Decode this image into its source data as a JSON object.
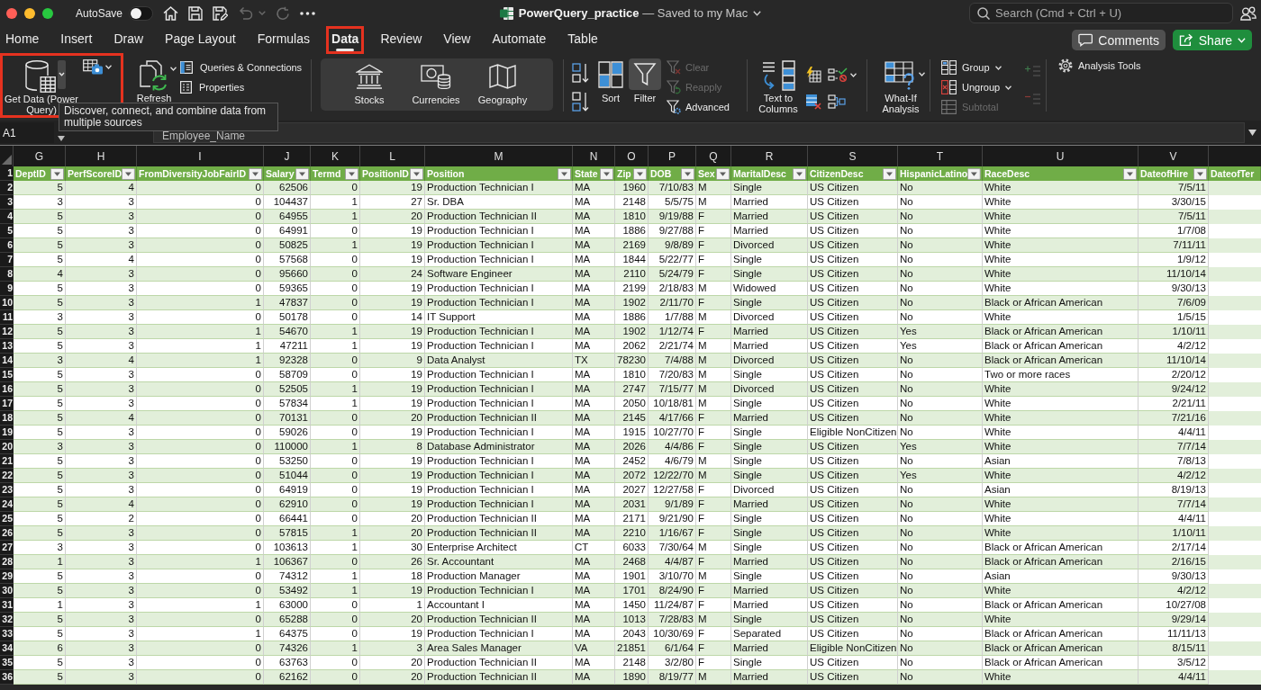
{
  "window": {
    "title": "**PowerQuery_practice** — Saved to my Mac",
    "autosave": {
      "label": "AutoSave",
      "on": false
    }
  },
  "search": {
    "placeholder": "Search (Cmd + Ctrl + U)"
  },
  "tabs": [
    {
      "label": "Home",
      "selected": false,
      "highlighted": false
    },
    {
      "label": "Insert",
      "selected": false,
      "highlighted": false
    },
    {
      "label": "Draw",
      "selected": false,
      "highlighted": false
    },
    {
      "label": "Page Layout",
      "selected": false,
      "highlighted": false
    },
    {
      "label": "Formulas",
      "selected": false,
      "highlighted": false
    },
    {
      "label": "Data",
      "selected": true,
      "highlighted": true
    },
    {
      "label": "Review",
      "selected": false,
      "highlighted": false
    },
    {
      "label": "View",
      "selected": false,
      "highlighted": false
    },
    {
      "label": "Automate",
      "selected": false,
      "highlighted": false
    },
    {
      "label": "Table",
      "selected": false,
      "highlighted": false
    }
  ],
  "actions": [
    {
      "label": "Comments",
      "kind": "comments"
    },
    {
      "label": "Share",
      "kind": "share"
    }
  ],
  "ribbon": {
    "get_data": {
      "label": "Get Data (Power Query)",
      "highlighted": true
    },
    "refresh": {
      "label": "Refresh"
    },
    "query_items": [
      {
        "label": "Queries & Connections",
        "kind": "queries"
      },
      {
        "label": "Properties",
        "kind": "properties"
      }
    ],
    "data_types": [
      {
        "label": "Stocks",
        "kind": "stocks"
      },
      {
        "label": "Currencies",
        "kind": "currencies"
      },
      {
        "label": "Geography",
        "kind": "geography"
      }
    ],
    "sort": {
      "label": "Sort"
    },
    "filter": {
      "label": "Filter",
      "on": true
    },
    "filter_items": [
      {
        "label": "Clear",
        "kind": "clear",
        "disabled": true
      },
      {
        "label": "Reapply",
        "kind": "reapply",
        "disabled": true
      },
      {
        "label": "Advanced",
        "kind": "advanced",
        "disabled": false
      }
    ],
    "text_to_columns": {
      "label": "Text to Columns"
    },
    "what_if": {
      "label": "What-If Analysis"
    },
    "outline_items": [
      {
        "label": "Group",
        "kind": "group",
        "disabled": false
      },
      {
        "label": "Ungroup",
        "kind": "ungroup",
        "disabled": false
      },
      {
        "label": "Subtotal",
        "kind": "subtotal",
        "disabled": true
      }
    ],
    "analysis_tools": {
      "label": "Analysis Tools"
    }
  },
  "tooltip": {
    "text": "Discover, connect, and combine data from multiple sources"
  },
  "formula_bar": {
    "name_box": "A1",
    "formula": "Employee_Name"
  },
  "sheet": {
    "column_letters": [
      "G",
      "H",
      "I",
      "J",
      "K",
      "L",
      "M",
      "N",
      "O",
      "P",
      "Q",
      "R",
      "S",
      "T",
      "U",
      "V"
    ],
    "header_row_number": "1",
    "columns": [
      {
        "label": "DeptID",
        "kind": "number"
      },
      {
        "label": "PerfScoreID",
        "kind": "number"
      },
      {
        "label": "FromDiversityJobFairID",
        "kind": "number"
      },
      {
        "label": "Salary",
        "kind": "number"
      },
      {
        "label": "Termd",
        "kind": "number"
      },
      {
        "label": "PositionID",
        "kind": "number"
      },
      {
        "label": "Position",
        "kind": "text"
      },
      {
        "label": "State",
        "kind": "text"
      },
      {
        "label": "Zip",
        "kind": "number"
      },
      {
        "label": "DOB",
        "kind": "date"
      },
      {
        "label": "Sex",
        "kind": "text"
      },
      {
        "label": "MaritalDesc",
        "kind": "text"
      },
      {
        "label": "CitizenDesc",
        "kind": "text"
      },
      {
        "label": "HispanicLatino",
        "kind": "text"
      },
      {
        "label": "RaceDesc",
        "kind": "text"
      },
      {
        "label": "DateofHire",
        "kind": "date"
      }
    ],
    "partial_column": "DateofTer",
    "rows": [
      {
        "number": "2",
        "cells": [
          "5",
          "4",
          "0",
          "62506",
          "0",
          "19",
          "Production Technician I",
          "MA",
          "1960",
          "7/10/83",
          "M",
          "Single",
          "US Citizen",
          "No",
          "White",
          "7/5/11"
        ]
      },
      {
        "number": "3",
        "cells": [
          "3",
          "3",
          "0",
          "104437",
          "1",
          "27",
          "Sr. DBA",
          "MA",
          "2148",
          "5/5/75",
          "M",
          "Married",
          "US Citizen",
          "No",
          "White",
          "3/30/15"
        ]
      },
      {
        "number": "4",
        "cells": [
          "5",
          "3",
          "0",
          "64955",
          "1",
          "20",
          "Production Technician II",
          "MA",
          "1810",
          "9/19/88",
          "F",
          "Married",
          "US Citizen",
          "No",
          "White",
          "7/5/11"
        ]
      },
      {
        "number": "5",
        "cells": [
          "5",
          "3",
          "0",
          "64991",
          "0",
          "19",
          "Production Technician I",
          "MA",
          "1886",
          "9/27/88",
          "F",
          "Married",
          "US Citizen",
          "No",
          "White",
          "1/7/08"
        ]
      },
      {
        "number": "6",
        "cells": [
          "5",
          "3",
          "0",
          "50825",
          "1",
          "19",
          "Production Technician I",
          "MA",
          "2169",
          "9/8/89",
          "F",
          "Divorced",
          "US Citizen",
          "No",
          "White",
          "7/11/11"
        ]
      },
      {
        "number": "7",
        "cells": [
          "5",
          "4",
          "0",
          "57568",
          "0",
          "19",
          "Production Technician I",
          "MA",
          "1844",
          "5/22/77",
          "F",
          "Single",
          "US Citizen",
          "No",
          "White",
          "1/9/12"
        ]
      },
      {
        "number": "8",
        "cells": [
          "4",
          "3",
          "0",
          "95660",
          "0",
          "24",
          "Software Engineer",
          "MA",
          "2110",
          "5/24/79",
          "F",
          "Single",
          "US Citizen",
          "No",
          "White",
          "11/10/14"
        ]
      },
      {
        "number": "9",
        "cells": [
          "5",
          "3",
          "0",
          "59365",
          "0",
          "19",
          "Production Technician I",
          "MA",
          "2199",
          "2/18/83",
          "M",
          "Widowed",
          "US Citizen",
          "No",
          "White",
          "9/30/13"
        ]
      },
      {
        "number": "10",
        "cells": [
          "5",
          "3",
          "1",
          "47837",
          "0",
          "19",
          "Production Technician I",
          "MA",
          "1902",
          "2/11/70",
          "F",
          "Single",
          "US Citizen",
          "No",
          "Black or African American",
          "7/6/09"
        ]
      },
      {
        "number": "11",
        "cells": [
          "3",
          "3",
          "0",
          "50178",
          "0",
          "14",
          "IT Support",
          "MA",
          "1886",
          "1/7/88",
          "M",
          "Divorced",
          "US Citizen",
          "No",
          "White",
          "1/5/15"
        ]
      },
      {
        "number": "12",
        "cells": [
          "5",
          "3",
          "1",
          "54670",
          "1",
          "19",
          "Production Technician I",
          "MA",
          "1902",
          "1/12/74",
          "F",
          "Married",
          "US Citizen",
          "Yes",
          "Black or African American",
          "1/10/11"
        ]
      },
      {
        "number": "13",
        "cells": [
          "5",
          "3",
          "1",
          "47211",
          "1",
          "19",
          "Production Technician I",
          "MA",
          "2062",
          "2/21/74",
          "M",
          "Married",
          "US Citizen",
          "Yes",
          "Black or African American",
          "4/2/12"
        ]
      },
      {
        "number": "14",
        "cells": [
          "3",
          "4",
          "1",
          "92328",
          "0",
          "9",
          "Data Analyst",
          "TX",
          "78230",
          "7/4/88",
          "M",
          "Divorced",
          "US Citizen",
          "No",
          "Black or African American",
          "11/10/14"
        ]
      },
      {
        "number": "15",
        "cells": [
          "5",
          "3",
          "0",
          "58709",
          "0",
          "19",
          "Production Technician I",
          "MA",
          "1810",
          "7/20/83",
          "M",
          "Single",
          "US Citizen",
          "No",
          "Two or more races",
          "2/20/12"
        ]
      },
      {
        "number": "16",
        "cells": [
          "5",
          "3",
          "0",
          "52505",
          "1",
          "19",
          "Production Technician I",
          "MA",
          "2747",
          "7/15/77",
          "M",
          "Divorced",
          "US Citizen",
          "No",
          "White",
          "9/24/12"
        ]
      },
      {
        "number": "17",
        "cells": [
          "5",
          "3",
          "0",
          "57834",
          "1",
          "19",
          "Production Technician I",
          "MA",
          "2050",
          "10/18/81",
          "M",
          "Single",
          "US Citizen",
          "No",
          "White",
          "2/21/11"
        ]
      },
      {
        "number": "18",
        "cells": [
          "5",
          "4",
          "0",
          "70131",
          "0",
          "20",
          "Production Technician II",
          "MA",
          "2145",
          "4/17/66",
          "F",
          "Married",
          "US Citizen",
          "No",
          "White",
          "7/21/16"
        ]
      },
      {
        "number": "19",
        "cells": [
          "5",
          "3",
          "0",
          "59026",
          "0",
          "19",
          "Production Technician I",
          "MA",
          "1915",
          "10/27/70",
          "F",
          "Single",
          "Eligible NonCitizen",
          "No",
          "White",
          "4/4/11"
        ]
      },
      {
        "number": "20",
        "cells": [
          "3",
          "3",
          "0",
          "110000",
          "1",
          "8",
          "Database Administrator",
          "MA",
          "2026",
          "4/4/86",
          "F",
          "Single",
          "US Citizen",
          "Yes",
          "White",
          "7/7/14"
        ]
      },
      {
        "number": "21",
        "cells": [
          "5",
          "3",
          "0",
          "53250",
          "0",
          "19",
          "Production Technician I",
          "MA",
          "2452",
          "4/6/79",
          "M",
          "Single",
          "US Citizen",
          "No",
          "Asian",
          "7/8/13"
        ]
      },
      {
        "number": "22",
        "cells": [
          "5",
          "3",
          "0",
          "51044",
          "0",
          "19",
          "Production Technician I",
          "MA",
          "2072",
          "12/22/70",
          "M",
          "Single",
          "US Citizen",
          "Yes",
          "White",
          "4/2/12"
        ]
      },
      {
        "number": "23",
        "cells": [
          "5",
          "3",
          "0",
          "64919",
          "0",
          "19",
          "Production Technician I",
          "MA",
          "2027",
          "12/27/58",
          "F",
          "Divorced",
          "US Citizen",
          "No",
          "Asian",
          "8/19/13"
        ]
      },
      {
        "number": "24",
        "cells": [
          "5",
          "4",
          "0",
          "62910",
          "0",
          "19",
          "Production Technician I",
          "MA",
          "2031",
          "9/1/89",
          "F",
          "Married",
          "US Citizen",
          "No",
          "White",
          "7/7/14"
        ]
      },
      {
        "number": "25",
        "cells": [
          "5",
          "2",
          "0",
          "66441",
          "0",
          "20",
          "Production Technician II",
          "MA",
          "2171",
          "9/21/90",
          "F",
          "Single",
          "US Citizen",
          "No",
          "White",
          "4/4/11"
        ]
      },
      {
        "number": "26",
        "cells": [
          "5",
          "3",
          "0",
          "57815",
          "1",
          "20",
          "Production Technician II",
          "MA",
          "2210",
          "1/16/67",
          "F",
          "Single",
          "US Citizen",
          "No",
          "White",
          "1/10/11"
        ]
      },
      {
        "number": "27",
        "cells": [
          "3",
          "3",
          "0",
          "103613",
          "1",
          "30",
          "Enterprise Architect",
          "CT",
          "6033",
          "7/30/64",
          "M",
          "Single",
          "US Citizen",
          "No",
          "Black or African American",
          "2/17/14"
        ]
      },
      {
        "number": "28",
        "cells": [
          "1",
          "3",
          "1",
          "106367",
          "0",
          "26",
          "Sr. Accountant",
          "MA",
          "2468",
          "4/4/87",
          "F",
          "Married",
          "US Citizen",
          "No",
          "Black or African American",
          "2/16/15"
        ]
      },
      {
        "number": "29",
        "cells": [
          "5",
          "3",
          "0",
          "74312",
          "1",
          "18",
          "Production Manager",
          "MA",
          "1901",
          "3/10/70",
          "M",
          "Single",
          "US Citizen",
          "No",
          "Asian",
          "9/30/13"
        ]
      },
      {
        "number": "30",
        "cells": [
          "5",
          "3",
          "0",
          "53492",
          "1",
          "19",
          "Production Technician I",
          "MA",
          "1701",
          "8/24/90",
          "F",
          "Married",
          "US Citizen",
          "No",
          "White",
          "4/2/12"
        ]
      },
      {
        "number": "31",
        "cells": [
          "1",
          "3",
          "1",
          "63000",
          "0",
          "1",
          "Accountant I",
          "MA",
          "1450",
          "11/24/87",
          "F",
          "Married",
          "US Citizen",
          "No",
          "Black or African American",
          "10/27/08"
        ]
      },
      {
        "number": "32",
        "cells": [
          "5",
          "3",
          "0",
          "65288",
          "0",
          "20",
          "Production Technician II",
          "MA",
          "1013",
          "7/28/83",
          "M",
          "Single",
          "US Citizen",
          "No",
          "White",
          "9/29/14"
        ]
      },
      {
        "number": "33",
        "cells": [
          "5",
          "3",
          "1",
          "64375",
          "0",
          "19",
          "Production Technician I",
          "MA",
          "2043",
          "10/30/69",
          "F",
          "Separated",
          "US Citizen",
          "No",
          "Black or African American",
          "11/11/13"
        ]
      },
      {
        "number": "34",
        "cells": [
          "6",
          "3",
          "0",
          "74326",
          "1",
          "3",
          "Area Sales Manager",
          "VA",
          "21851",
          "6/1/64",
          "F",
          "Married",
          "Eligible NonCitizen",
          "No",
          "Black or African American",
          "8/15/11"
        ]
      },
      {
        "number": "35",
        "cells": [
          "5",
          "3",
          "0",
          "63763",
          "0",
          "20",
          "Production Technician II",
          "MA",
          "2148",
          "3/2/80",
          "F",
          "Single",
          "US Citizen",
          "No",
          "Black or African American",
          "3/5/12"
        ]
      },
      {
        "number": "36",
        "cells": [
          "5",
          "3",
          "0",
          "62162",
          "0",
          "20",
          "Production Technician II",
          "MA",
          "1890",
          "8/19/77",
          "M",
          "Married",
          "US Citizen",
          "No",
          "White",
          "4/4/11"
        ]
      }
    ]
  }
}
